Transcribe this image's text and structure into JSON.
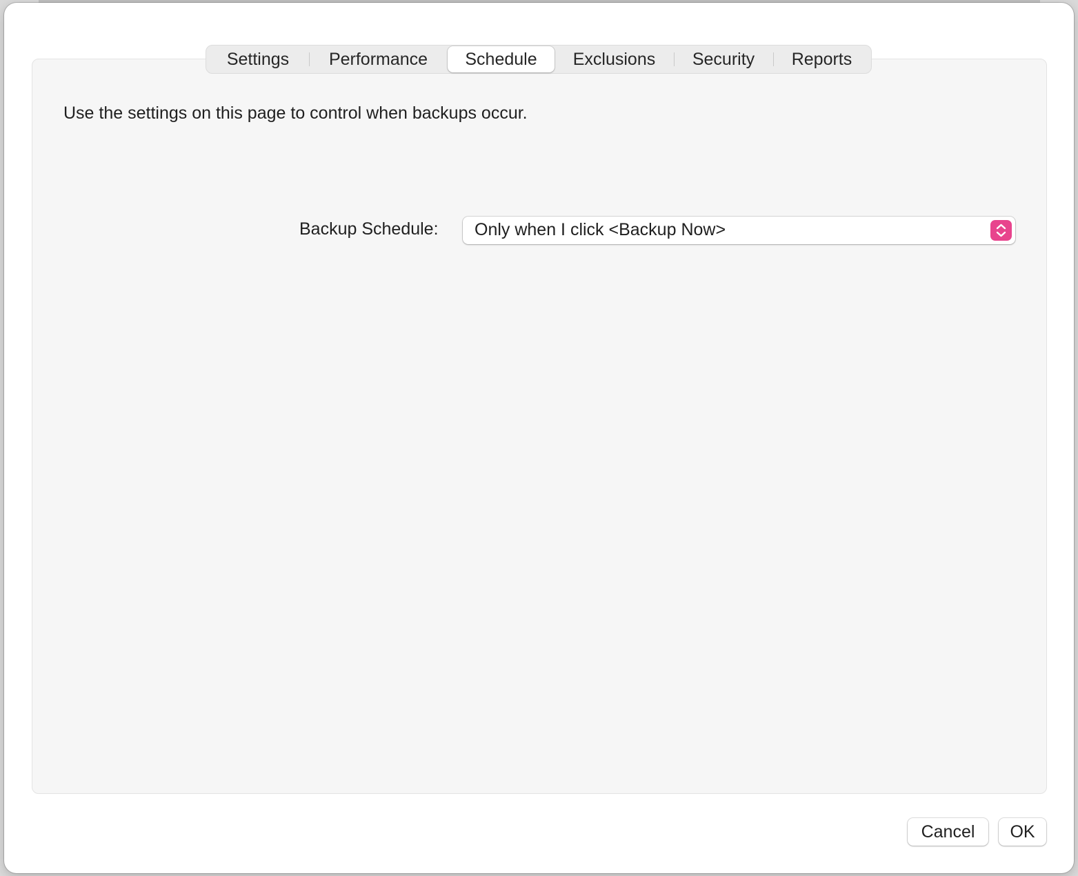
{
  "tabs": [
    {
      "label": "Settings",
      "active": false
    },
    {
      "label": "Performance",
      "active": false
    },
    {
      "label": "Schedule",
      "active": true
    },
    {
      "label": "Exclusions",
      "active": false
    },
    {
      "label": "Security",
      "active": false
    },
    {
      "label": "Reports",
      "active": false
    }
  ],
  "schedule": {
    "description": "Use the settings on this page to control when backups occur.",
    "backup_schedule_label": "Backup Schedule:",
    "backup_schedule_value": "Only when I click <Backup Now>",
    "stepper_icon": "chevron-up-down-icon",
    "accent_color": "#e8448d"
  },
  "buttons": {
    "cancel_label": "Cancel",
    "ok_label": "OK"
  }
}
